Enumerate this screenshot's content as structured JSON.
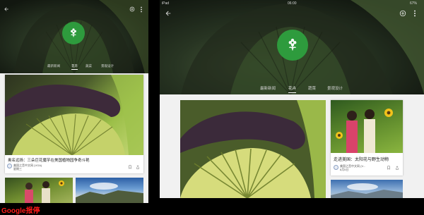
{
  "caption": "Google报停",
  "phone": {
    "tabs": [
      {
        "label": "最新新闻",
        "active": false
      },
      {
        "label": "花卉",
        "active": true
      },
      {
        "label": "蔬菜",
        "active": false
      },
      {
        "label": "景观设计",
        "active": false
      }
    ],
    "card": {
      "title": "奥名远扬：三朵巨花魔芋在美国植物园争奇斗艳",
      "author": "美国之音中文网 (VOA)",
      "date": "星期三"
    }
  },
  "tablet": {
    "status": {
      "carrier": "iPad",
      "time": "06:00",
      "battery": "67%"
    },
    "tabs": [
      {
        "label": "最新新闻",
        "active": false
      },
      {
        "label": "花卉",
        "active": true
      },
      {
        "label": "蔬菜",
        "active": false
      },
      {
        "label": "景观设计",
        "active": false
      }
    ],
    "card": {
      "title": "走进美国：太阳花与野生动物",
      "author": "美国之音中文网 (V...",
      "date": "8月5日"
    }
  },
  "colors": {
    "accent_green": "#2e9b3d",
    "caption_red": "#ff1a1a"
  },
  "icons": [
    "back-arrow-icon",
    "add-circle-icon",
    "more-vert-icon",
    "flower-icon",
    "bookmark-icon",
    "share-icon"
  ]
}
